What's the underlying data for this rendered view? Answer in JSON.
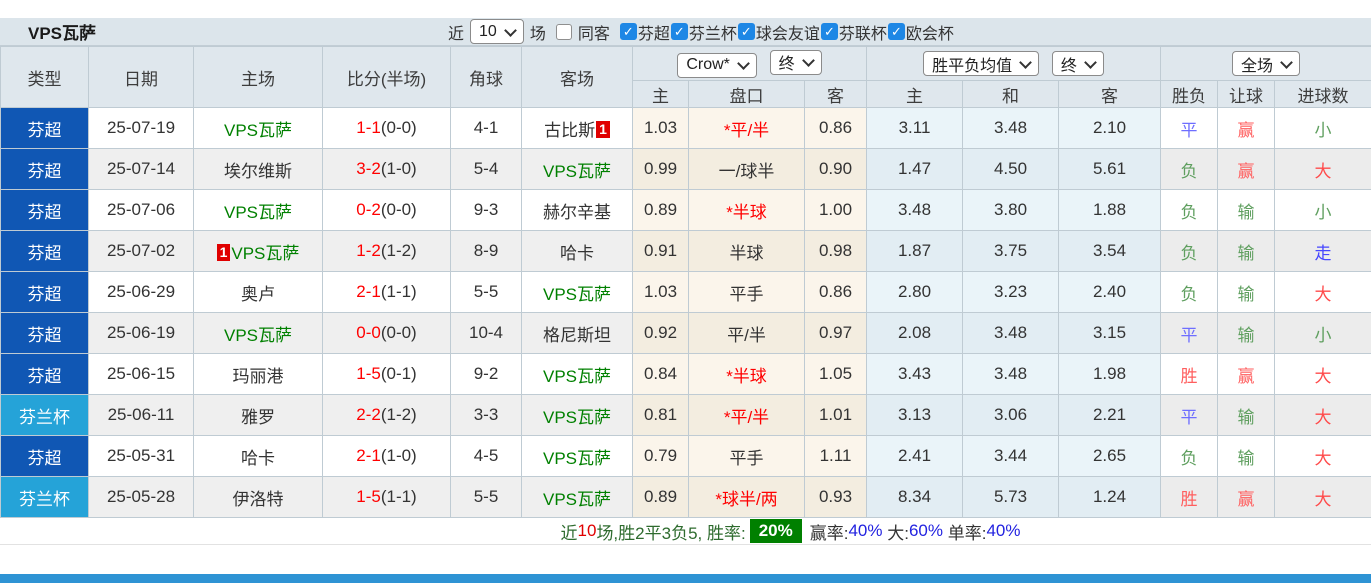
{
  "title": "VPS瓦萨",
  "controls": {
    "recent_label": "近",
    "recent_value": "10",
    "matches_label": "场",
    "same_opponent": {
      "label": "同客",
      "checked": false
    },
    "leagues": [
      {
        "label": "芬超",
        "checked": true
      },
      {
        "label": "芬兰杯",
        "checked": true
      },
      {
        "label": "球会友谊",
        "checked": true
      },
      {
        "label": "芬联杯",
        "checked": true
      },
      {
        "label": "欧会杯",
        "checked": true
      }
    ]
  },
  "selectors": {
    "company": "Crow*",
    "company_time": "终",
    "avg": "胜平负均值",
    "avg_time": "终",
    "scope": "全场"
  },
  "table": {
    "headers": {
      "type": "类型",
      "date": "日期",
      "home": "主场",
      "score": "比分(半场)",
      "corner": "角球",
      "away": "客场",
      "odds_home": "主",
      "handicap": "盘口",
      "odds_away": "客",
      "avg_home": "主",
      "avg_draw": "和",
      "avg_away": "客",
      "res_wdl": "胜负",
      "res_handicap": "让球",
      "res_goals": "进球数"
    },
    "rows": [
      {
        "type": "芬超",
        "type_style": "super",
        "date": "25-07-19",
        "home": "VPS瓦萨",
        "home_vps": true,
        "home_badge": "",
        "score": "1-1",
        "half": "(0-0)",
        "corner": "4-1",
        "away": "古比斯",
        "away_vps": false,
        "away_badge": "1",
        "odds_home": "1.03",
        "handicap": "*平/半",
        "handicap_red": true,
        "odds_away": "0.86",
        "avg_home": "3.11",
        "avg_draw": "3.48",
        "avg_away": "2.10",
        "res_wdl": {
          "text": "平",
          "color": "draw"
        },
        "res_handicap": {
          "text": "赢",
          "color": "win"
        },
        "res_goals": {
          "text": "小",
          "color": "small"
        }
      },
      {
        "type": "芬超",
        "type_style": "super",
        "date": "25-07-14",
        "home": "埃尔维斯",
        "home_vps": false,
        "home_badge": "",
        "score": "3-2",
        "half": "(1-0)",
        "corner": "5-4",
        "away": "VPS瓦萨",
        "away_vps": true,
        "away_badge": "",
        "odds_home": "0.99",
        "handicap": "一/球半",
        "handicap_red": false,
        "odds_away": "0.90",
        "avg_home": "1.47",
        "avg_draw": "4.50",
        "avg_away": "5.61",
        "res_wdl": {
          "text": "负",
          "color": "lose"
        },
        "res_handicap": {
          "text": "赢",
          "color": "win"
        },
        "res_goals": {
          "text": "大",
          "color": "big"
        }
      },
      {
        "type": "芬超",
        "type_style": "super",
        "date": "25-07-06",
        "home": "VPS瓦萨",
        "home_vps": true,
        "home_badge": "",
        "score": "0-2",
        "half": "(0-0)",
        "corner": "9-3",
        "away": "赫尔辛基",
        "away_vps": false,
        "away_badge": "",
        "odds_home": "0.89",
        "handicap": "*半球",
        "handicap_red": true,
        "odds_away": "1.00",
        "avg_home": "3.48",
        "avg_draw": "3.80",
        "avg_away": "1.88",
        "res_wdl": {
          "text": "负",
          "color": "lose"
        },
        "res_handicap": {
          "text": "输",
          "color": "lose"
        },
        "res_goals": {
          "text": "小",
          "color": "small"
        }
      },
      {
        "type": "芬超",
        "type_style": "super",
        "date": "25-07-02",
        "home": "VPS瓦萨",
        "home_vps": true,
        "home_badge": "1",
        "score": "1-2",
        "half": "(1-2)",
        "corner": "8-9",
        "away": "哈卡",
        "away_vps": false,
        "away_badge": "",
        "odds_home": "0.91",
        "handicap": "半球",
        "handicap_red": false,
        "odds_away": "0.98",
        "avg_home": "1.87",
        "avg_draw": "3.75",
        "avg_away": "3.54",
        "res_wdl": {
          "text": "负",
          "color": "lose"
        },
        "res_handicap": {
          "text": "输",
          "color": "lose"
        },
        "res_goals": {
          "text": "走",
          "color": "go"
        }
      },
      {
        "type": "芬超",
        "type_style": "super",
        "date": "25-06-29",
        "home": "奥卢",
        "home_vps": false,
        "home_badge": "",
        "score": "2-1",
        "half": "(1-1)",
        "corner": "5-5",
        "away": "VPS瓦萨",
        "away_vps": true,
        "away_badge": "",
        "odds_home": "1.03",
        "handicap": "平手",
        "handicap_red": false,
        "odds_away": "0.86",
        "avg_home": "2.80",
        "avg_draw": "3.23",
        "avg_away": "2.40",
        "res_wdl": {
          "text": "负",
          "color": "lose"
        },
        "res_handicap": {
          "text": "输",
          "color": "lose"
        },
        "res_goals": {
          "text": "大",
          "color": "big"
        }
      },
      {
        "type": "芬超",
        "type_style": "super",
        "date": "25-06-19",
        "home": "VPS瓦萨",
        "home_vps": true,
        "home_badge": "",
        "score": "0-0",
        "half": "(0-0)",
        "corner": "10-4",
        "away": "格尼斯坦",
        "away_vps": false,
        "away_badge": "",
        "odds_home": "0.92",
        "handicap": "平/半",
        "handicap_red": false,
        "odds_away": "0.97",
        "avg_home": "2.08",
        "avg_draw": "3.48",
        "avg_away": "3.15",
        "res_wdl": {
          "text": "平",
          "color": "draw"
        },
        "res_handicap": {
          "text": "输",
          "color": "lose"
        },
        "res_goals": {
          "text": "小",
          "color": "small"
        }
      },
      {
        "type": "芬超",
        "type_style": "super",
        "date": "25-06-15",
        "home": "玛丽港",
        "home_vps": false,
        "home_badge": "",
        "score": "1-5",
        "half": "(0-1)",
        "corner": "9-2",
        "away": "VPS瓦萨",
        "away_vps": true,
        "away_badge": "",
        "odds_home": "0.84",
        "handicap": "*半球",
        "handicap_red": true,
        "odds_away": "1.05",
        "avg_home": "3.43",
        "avg_draw": "3.48",
        "avg_away": "1.98",
        "res_wdl": {
          "text": "胜",
          "color": "win"
        },
        "res_handicap": {
          "text": "赢",
          "color": "win"
        },
        "res_goals": {
          "text": "大",
          "color": "big"
        }
      },
      {
        "type": "芬兰杯",
        "type_style": "cup",
        "date": "25-06-11",
        "home": "雅罗",
        "home_vps": false,
        "home_badge": "",
        "score": "2-2",
        "half": "(1-2)",
        "corner": "3-3",
        "away": "VPS瓦萨",
        "away_vps": true,
        "away_badge": "",
        "odds_home": "0.81",
        "handicap": "*平/半",
        "handicap_red": true,
        "odds_away": "1.01",
        "avg_home": "3.13",
        "avg_draw": "3.06",
        "avg_away": "2.21",
        "res_wdl": {
          "text": "平",
          "color": "draw"
        },
        "res_handicap": {
          "text": "输",
          "color": "lose"
        },
        "res_goals": {
          "text": "大",
          "color": "big"
        }
      },
      {
        "type": "芬超",
        "type_style": "super",
        "date": "25-05-31",
        "home": "哈卡",
        "home_vps": false,
        "home_badge": "",
        "score": "2-1",
        "half": "(1-0)",
        "corner": "4-5",
        "away": "VPS瓦萨",
        "away_vps": true,
        "away_badge": "",
        "odds_home": "0.79",
        "handicap": "平手",
        "handicap_red": false,
        "odds_away": "1.11",
        "avg_home": "2.41",
        "avg_draw": "3.44",
        "avg_away": "2.65",
        "res_wdl": {
          "text": "负",
          "color": "lose"
        },
        "res_handicap": {
          "text": "输",
          "color": "lose"
        },
        "res_goals": {
          "text": "大",
          "color": "big"
        }
      },
      {
        "type": "芬兰杯",
        "type_style": "cup",
        "date": "25-05-28",
        "home": "伊洛特",
        "home_vps": false,
        "home_badge": "",
        "score": "1-5",
        "half": "(1-1)",
        "corner": "5-5",
        "away": "VPS瓦萨",
        "away_vps": true,
        "away_badge": "",
        "odds_home": "0.89",
        "handicap": "*球半/两",
        "handicap_red": true,
        "odds_away": "0.93",
        "avg_home": "8.34",
        "avg_draw": "5.73",
        "avg_away": "1.24",
        "res_wdl": {
          "text": "胜",
          "color": "win"
        },
        "res_handicap": {
          "text": "赢",
          "color": "win"
        },
        "res_goals": {
          "text": "大",
          "color": "big"
        }
      }
    ]
  },
  "footer": {
    "segments": [
      {
        "text": "近",
        "color": "green"
      },
      {
        "text": "10",
        "color": "red"
      },
      {
        "text": "场,胜2平3负5, 胜率:",
        "color": "green"
      },
      {
        "text": "20%",
        "color": "badge"
      },
      {
        "text": "赢率:",
        "color": "dark"
      },
      {
        "text": "40%",
        "color": "blue"
      },
      {
        "text": " 大:",
        "color": "dark"
      },
      {
        "text": "60%",
        "color": "blue"
      },
      {
        "text": " 单率:",
        "color": "dark"
      },
      {
        "text": "40%",
        "color": "blue"
      }
    ]
  },
  "colors": {
    "win": "#ff5e5e",
    "draw": "#6e6eff",
    "lose": "#5f9f5f",
    "small": "#5f9f5f",
    "big": "#ff4b4b",
    "go": "#4646ff",
    "score_red": "#ff0000",
    "vps_green": "#008000",
    "league_super": "#1057b4",
    "league_cup": "#25a3d8",
    "badge_red": "#e00000",
    "blue_value": "#2222e0",
    "footer_green": "#2e6b2e",
    "footer_red": "#e00000",
    "footer_dark": "#333333",
    "win_rate_badge_bg": "#008000",
    "top_bar_green": "#008000",
    "top_bar_red": "#f00000",
    "bottom_bar": "#2e93d4"
  }
}
